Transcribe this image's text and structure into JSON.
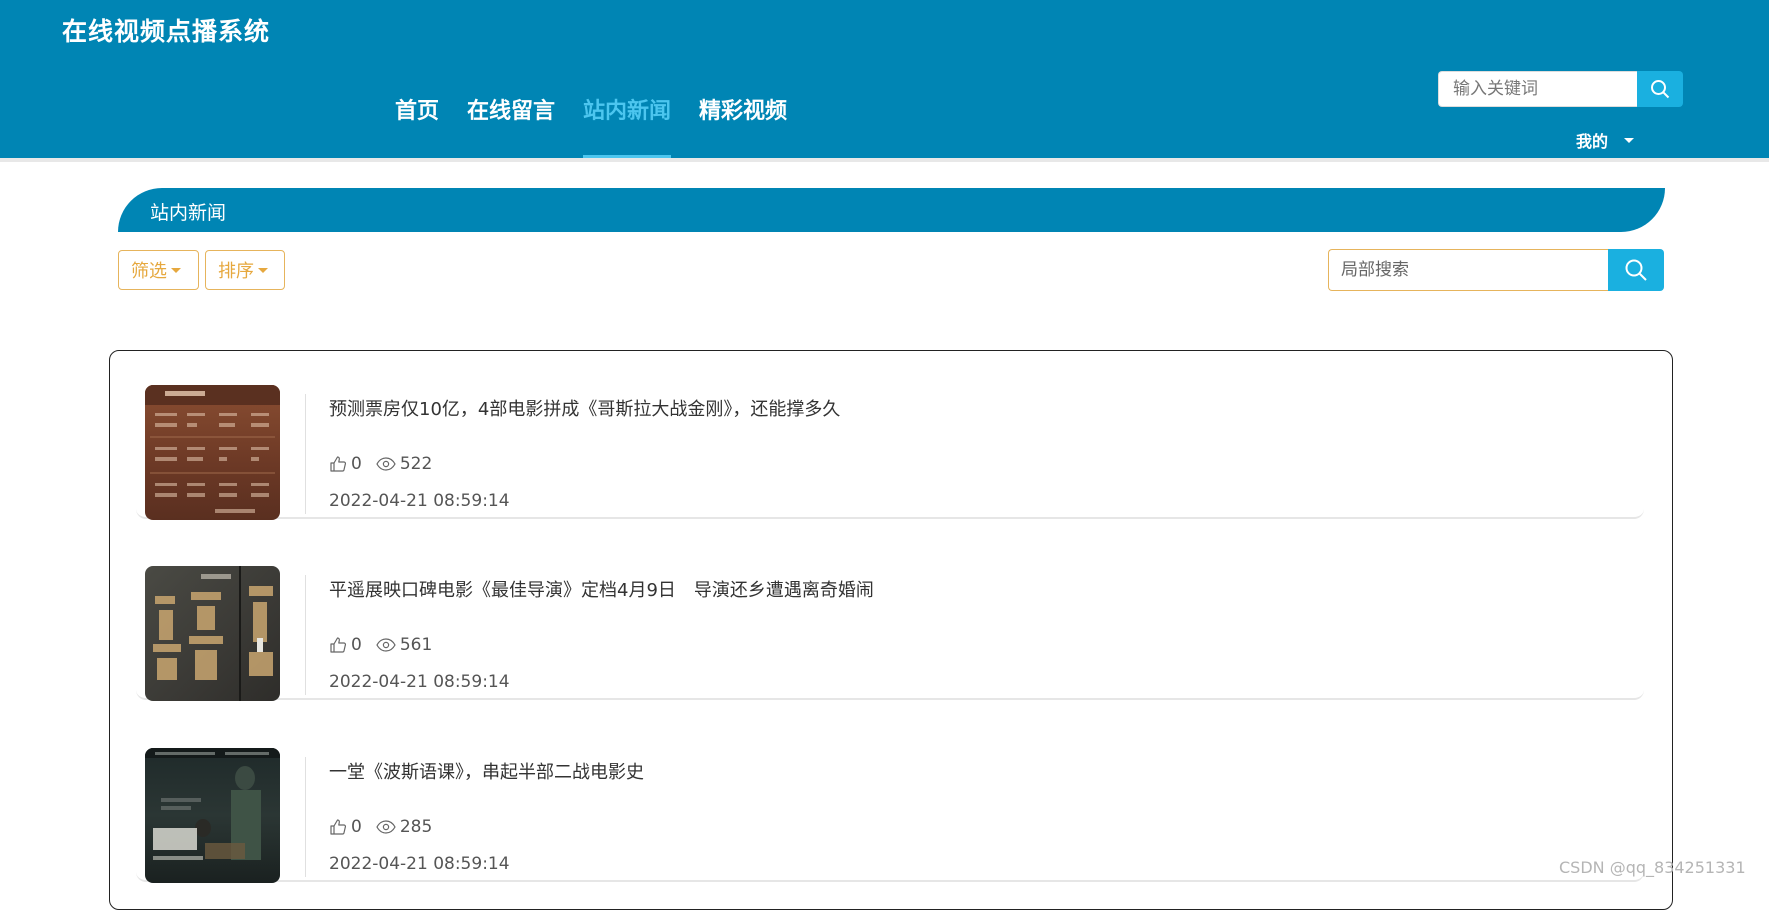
{
  "header": {
    "site_title": "在线视频点播系统",
    "nav": [
      {
        "label": "首页",
        "active": false
      },
      {
        "label": "在线留言",
        "active": false
      },
      {
        "label": "站内新闻",
        "active": true
      },
      {
        "label": "精彩视频",
        "active": false
      }
    ],
    "search_placeholder": "输入关键词",
    "user_menu": "我的"
  },
  "section": {
    "title": "站内新闻"
  },
  "toolbar": {
    "filter_label": "筛选",
    "sort_label": "排序",
    "local_search_placeholder": "局部搜索"
  },
  "news": [
    {
      "title": "预测票房仅10亿，4部电影拼成《哥斯拉大战金刚》，还能撑多久",
      "likes": "0",
      "views": "522",
      "date": "2022-04-21 08:59:14"
    },
    {
      "title": "平遥展映口碑电影《最佳导演》定档4月9日　导演还乡遭遇离奇婚闹",
      "likes": "0",
      "views": "561",
      "date": "2022-04-21 08:59:14"
    },
    {
      "title": "一堂《波斯语课》，串起半部二战电影史",
      "likes": "0",
      "views": "285",
      "date": "2022-04-21 08:59:14"
    }
  ],
  "watermark": "CSDN @qq_834251331",
  "colors": {
    "primary": "#0085b4",
    "accent": "#1ab0e0",
    "gold": "#e6a83e",
    "nav_active": "#4cc6ef"
  }
}
